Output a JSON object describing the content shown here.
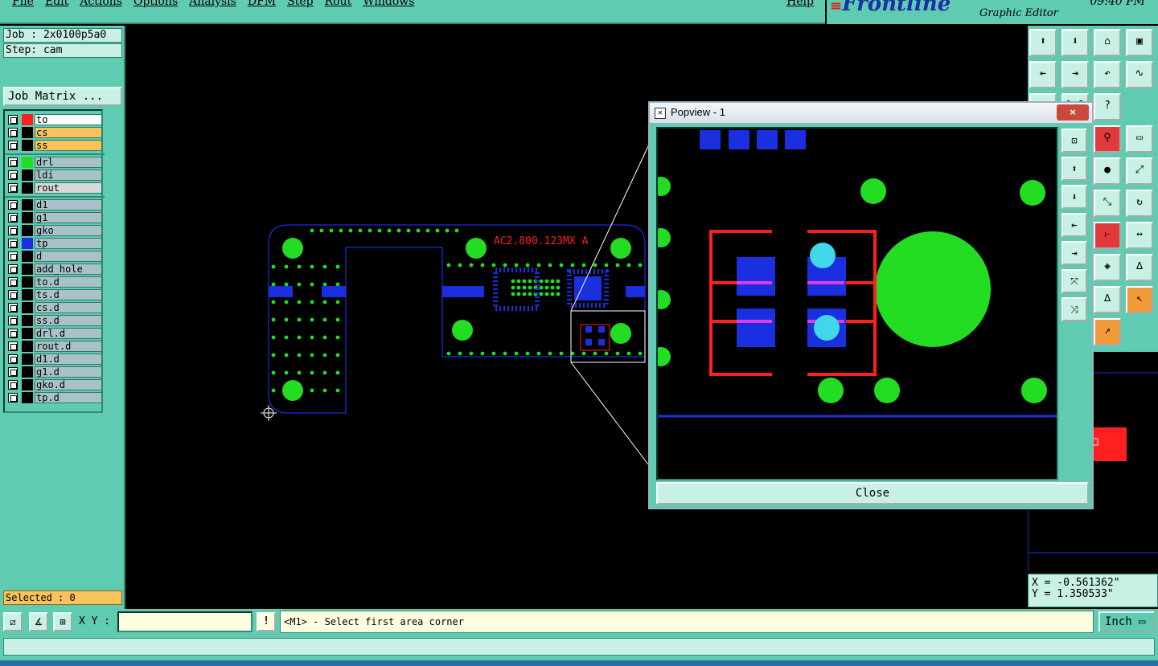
{
  "menu": {
    "items": [
      "File",
      "Edit",
      "Actions",
      "Options",
      "Analysis",
      "DFM",
      "Step",
      "Rout",
      "Windows"
    ],
    "help": "Help"
  },
  "brand": {
    "logo": "Frontline",
    "subtitle": "Graphic Editor",
    "clock": "09:40 PM"
  },
  "job": {
    "job_label": "Job : 2x0100p5a0",
    "step_label": "Step: cam",
    "matrix_button": "Job Matrix ..."
  },
  "layers": [
    {
      "name": "to",
      "swatch": "#ff1f1f",
      "bg": "#ffffff"
    },
    {
      "name": "cs",
      "swatch": "#000000",
      "bg": "#f7c35a"
    },
    {
      "name": "ss",
      "swatch": "#000000",
      "bg": "#f7c35a"
    },
    {
      "name": "drl",
      "swatch": "#22dd22",
      "bg": "#a9c1c8"
    },
    {
      "name": "ldi",
      "swatch": "#000000",
      "bg": "#a9c1c8"
    },
    {
      "name": "rout",
      "swatch": "#000000",
      "bg": "#d8d8d8"
    },
    {
      "name": "d1",
      "swatch": "#000000",
      "bg": "#a9c1c8"
    },
    {
      "name": "g1",
      "swatch": "#000000",
      "bg": "#a9c1c8"
    },
    {
      "name": "gko",
      "swatch": "#000000",
      "bg": "#a9c1c8"
    },
    {
      "name": "tp",
      "swatch": "#1a2fe0",
      "bg": "#a9c1c8"
    },
    {
      "name": "d",
      "swatch": "#000000",
      "bg": "#a9c1c8"
    },
    {
      "name": "add_hole",
      "swatch": "#000000",
      "bg": "#a9c1c8"
    },
    {
      "name": "to.d",
      "swatch": "#000000",
      "bg": "#a9c1c8"
    },
    {
      "name": "ts.d",
      "swatch": "#000000",
      "bg": "#a9c1c8"
    },
    {
      "name": "cs.d",
      "swatch": "#000000",
      "bg": "#a9c1c8"
    },
    {
      "name": "ss.d",
      "swatch": "#000000",
      "bg": "#a9c1c8"
    },
    {
      "name": "drl.d",
      "swatch": "#000000",
      "bg": "#a9c1c8"
    },
    {
      "name": "rout.d",
      "swatch": "#000000",
      "bg": "#a9c1c8"
    },
    {
      "name": "d1.d",
      "swatch": "#000000",
      "bg": "#a9c1c8"
    },
    {
      "name": "g1.d",
      "swatch": "#000000",
      "bg": "#a9c1c8"
    },
    {
      "name": "gko.d",
      "swatch": "#000000",
      "bg": "#a9c1c8"
    },
    {
      "name": "tp.d",
      "swatch": "#000000",
      "bg": "#a9c1c8"
    }
  ],
  "selected": "Selected : 0",
  "command": {
    "xy_label": "X Y :",
    "xy_value": "",
    "bang": "!",
    "prompt": "<M1> - Select first area corner",
    "unit": "Inch"
  },
  "coords": {
    "x": "X = -0.561362\"",
    "y": "Y = 1.350533\""
  },
  "board": {
    "marking": "AC2.800.123MX  A"
  },
  "popview": {
    "title": "Popview - 1",
    "close_label": "Close",
    "close_x": "×"
  },
  "icons": {
    "right_tools": [
      "move-up-icon",
      "move-down-icon",
      "home-icon",
      "window-icon",
      "move-left-icon",
      "move-right-icon",
      "undo-icon",
      "zigzag-icon",
      "page-icon",
      "scale-1-2-icon",
      "help-icon",
      "snap-icon",
      "ruler-icon",
      "pad-icon",
      "measure-icon",
      "measure-alt-icon",
      "rotate-icon",
      "pin-icon",
      "span-icon",
      "shapes-icon",
      "arc-icon",
      "arc-alt-icon",
      "select-icon",
      "select-alt-icon"
    ]
  },
  "colors": {
    "panel": "#5fcbb0",
    "copper": "#1a2fe0",
    "drill": "#22dd22",
    "silk": "#ff1f1f"
  }
}
